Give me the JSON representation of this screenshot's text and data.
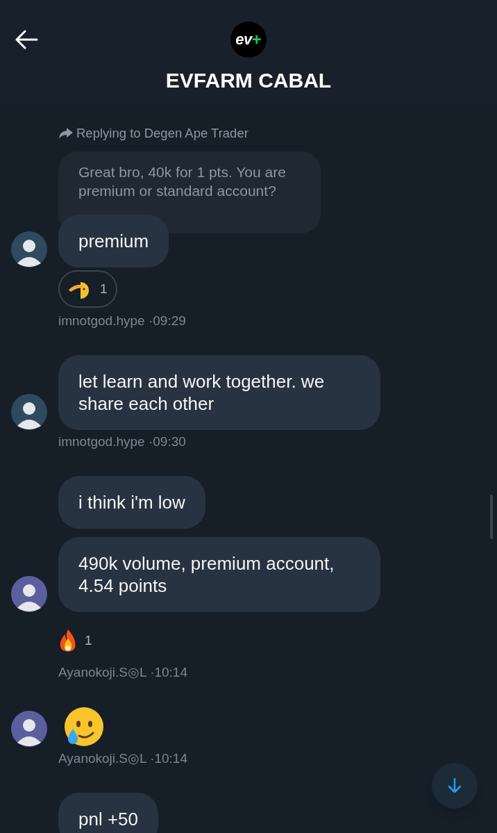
{
  "header": {
    "logo_text": "ev",
    "logo_mark": "+",
    "title": "EVFARM CABAL"
  },
  "groups": [
    {
      "reply": {
        "label": "Replying to Degen Ape Trader",
        "quote": "Great bro, 40k for 1 pts. You are premium or standard account?"
      },
      "avatar": {
        "color": "#2e4a5e"
      },
      "messages": [
        {
          "kind": "text",
          "text": "premium"
        }
      ],
      "reactions": [
        {
          "kind": "salute",
          "count": "1",
          "selected": true
        }
      ],
      "meta": "imnotgod.hype ·09:29"
    },
    {
      "avatar": {
        "color": "#2e4a5e"
      },
      "messages": [
        {
          "kind": "text",
          "text": "let learn and work together. we share each other"
        }
      ],
      "meta": "imnotgod.hype ·09:30"
    },
    {
      "avatar": {
        "color": "#5b5f9e"
      },
      "messages": [
        {
          "kind": "text",
          "text": "i think i'm low"
        },
        {
          "kind": "text",
          "text": "490k volume, premium account, 4.54 points"
        }
      ],
      "reactions": [
        {
          "kind": "fire",
          "count": "1",
          "selected": false
        }
      ],
      "meta": "Ayanokoji.S◎L ·10:14"
    },
    {
      "avatar": {
        "color": "#5b5f9e"
      },
      "messages": [
        {
          "kind": "emoji"
        }
      ],
      "meta": "Ayanokoji.S◎L ·10:14"
    },
    {
      "messages": [
        {
          "kind": "text",
          "text": "pnl +50"
        }
      ]
    }
  ]
}
